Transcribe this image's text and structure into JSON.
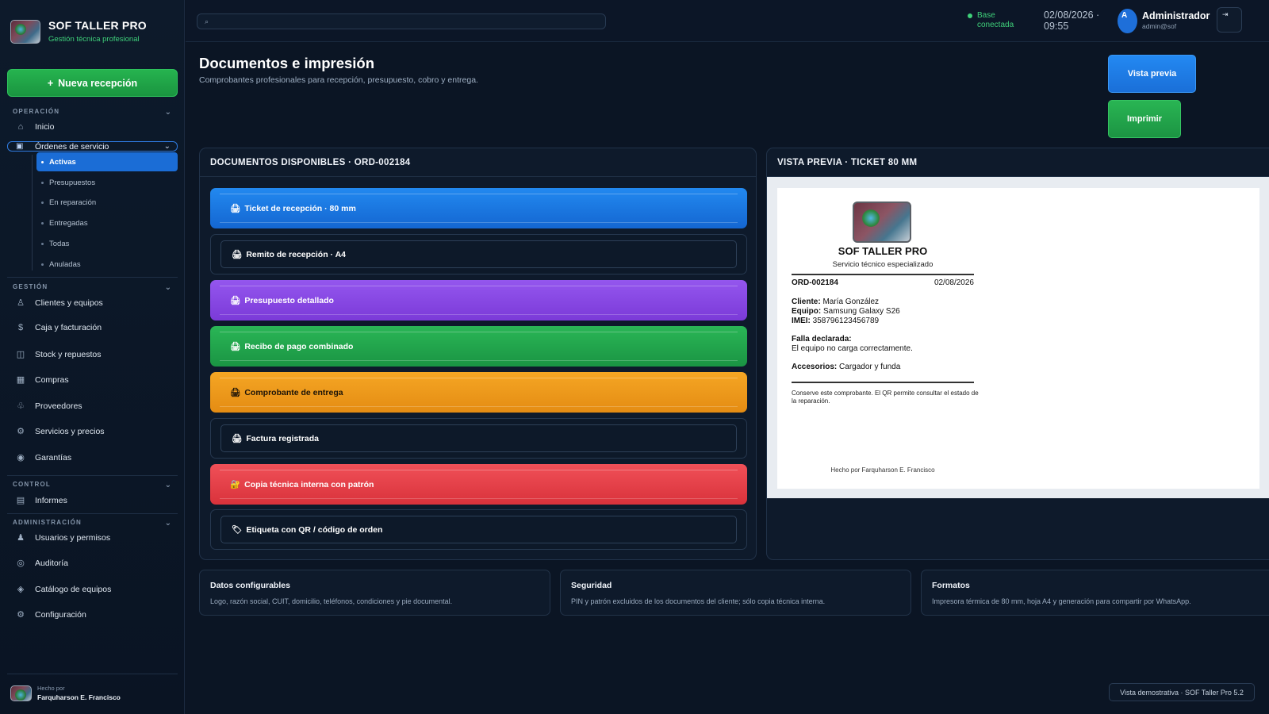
{
  "brand": {
    "title": "SOF TALLER PRO",
    "subtitle": "Gestión técnica profesional",
    "accent": "#3fd07a"
  },
  "sidebar": {
    "new_button": "Nueva recepción",
    "new_button_icon": "+",
    "sections": {
      "operacion": "OPERACIÓN",
      "gestion": "GESTIÓN",
      "control": "CONTROL",
      "administracion": "ADMINISTRACIÓN"
    },
    "operacion_items": {
      "inicio": "Inicio",
      "ordenes": "Órdenes de servicio"
    },
    "ordenes_sub": [
      "Activas",
      "Presupuestos",
      "En reparación",
      "Entregadas",
      "Todas",
      "Anuladas"
    ],
    "gestion_items": [
      "Clientes y equipos",
      "Caja y facturación",
      "Stock y repuestos",
      "Compras",
      "Proveedores",
      "Servicios y precios",
      "Garantías"
    ],
    "control_items": [
      "Informes"
    ],
    "admin_items": [
      "Usuarios y permisos",
      "Auditoría",
      "Catálogo de equipos",
      "Configuración"
    ],
    "footer": {
      "label": "Hecho por",
      "name": "Farquharson E. Francisco"
    }
  },
  "topbar": {
    "search_icon": "⌕",
    "status": {
      "line1": "Base",
      "line2": "conectada",
      "color": "#3fd07a"
    },
    "clock": {
      "date": "02/08/2026 ·",
      "time": "09:55"
    },
    "user": {
      "initial": "A",
      "name": "Administrador",
      "email": "admin@sof"
    },
    "logout_icon": "⇥"
  },
  "main": {
    "title": "Documentos e impresión",
    "subtitle": "Comprobantes profesionales para recepción, presupuesto, cobro y entrega.",
    "preview_button": "Vista previa",
    "print_button": "Imprimir",
    "docs_header": "DOCUMENTOS DISPONIBLES · ORD-002184",
    "documents": [
      {
        "icon": "🖨",
        "label": "Ticket de recepción · 80 mm"
      },
      {
        "icon": "🖨",
        "label": "Remito de recepción · A4"
      },
      {
        "icon": "🖨",
        "label": "Presupuesto detallado"
      },
      {
        "icon": "🖨",
        "label": "Recibo de pago combinado"
      },
      {
        "icon": "🖨",
        "label": "Comprobante de entrega"
      },
      {
        "icon": "🖨",
        "label": "Factura registrada"
      },
      {
        "icon": "🔐",
        "label": "Copia técnica interna con patrón"
      },
      {
        "icon": "🏷",
        "label": "Etiqueta con QR / código de orden"
      }
    ],
    "preview_header": "VISTA PREVIA · TICKET 80 MM",
    "ticket": {
      "company": "SOF TALLER PRO",
      "tagline": "Servicio técnico especializado",
      "order": "ORD-002184",
      "date": "02/08/2026",
      "client_label": "Cliente:",
      "client": "María González",
      "device_label": "Equipo:",
      "device": "Samsung Galaxy S26",
      "imei_label": "IMEI:",
      "imei": "358796123456789",
      "fault_label": "Falla declarada:",
      "fault": "El equipo no carga correctamente.",
      "accessories_label": "Accesorios:",
      "accessories": "Cargador y funda",
      "note": "Conserve este comprobante. El QR permite consultar el estado de la reparación.",
      "footer": "Hecho por Farquharson E. Francisco"
    },
    "cards": [
      {
        "title": "Datos configurables",
        "text": "Logo, razón social, CUIT, domicilio, teléfonos, condiciones y pie documental."
      },
      {
        "title": "Seguridad",
        "text": "PIN y patrón excluidos de los documentos del cliente; sólo copia técnica interna."
      },
      {
        "title": "Formatos",
        "text": "Impresora térmica de 80 mm, hoja A4 y generación para compartir por WhatsApp."
      }
    ],
    "demo_badge": "Vista demostrativa · SOF Taller Pro 5.2"
  }
}
